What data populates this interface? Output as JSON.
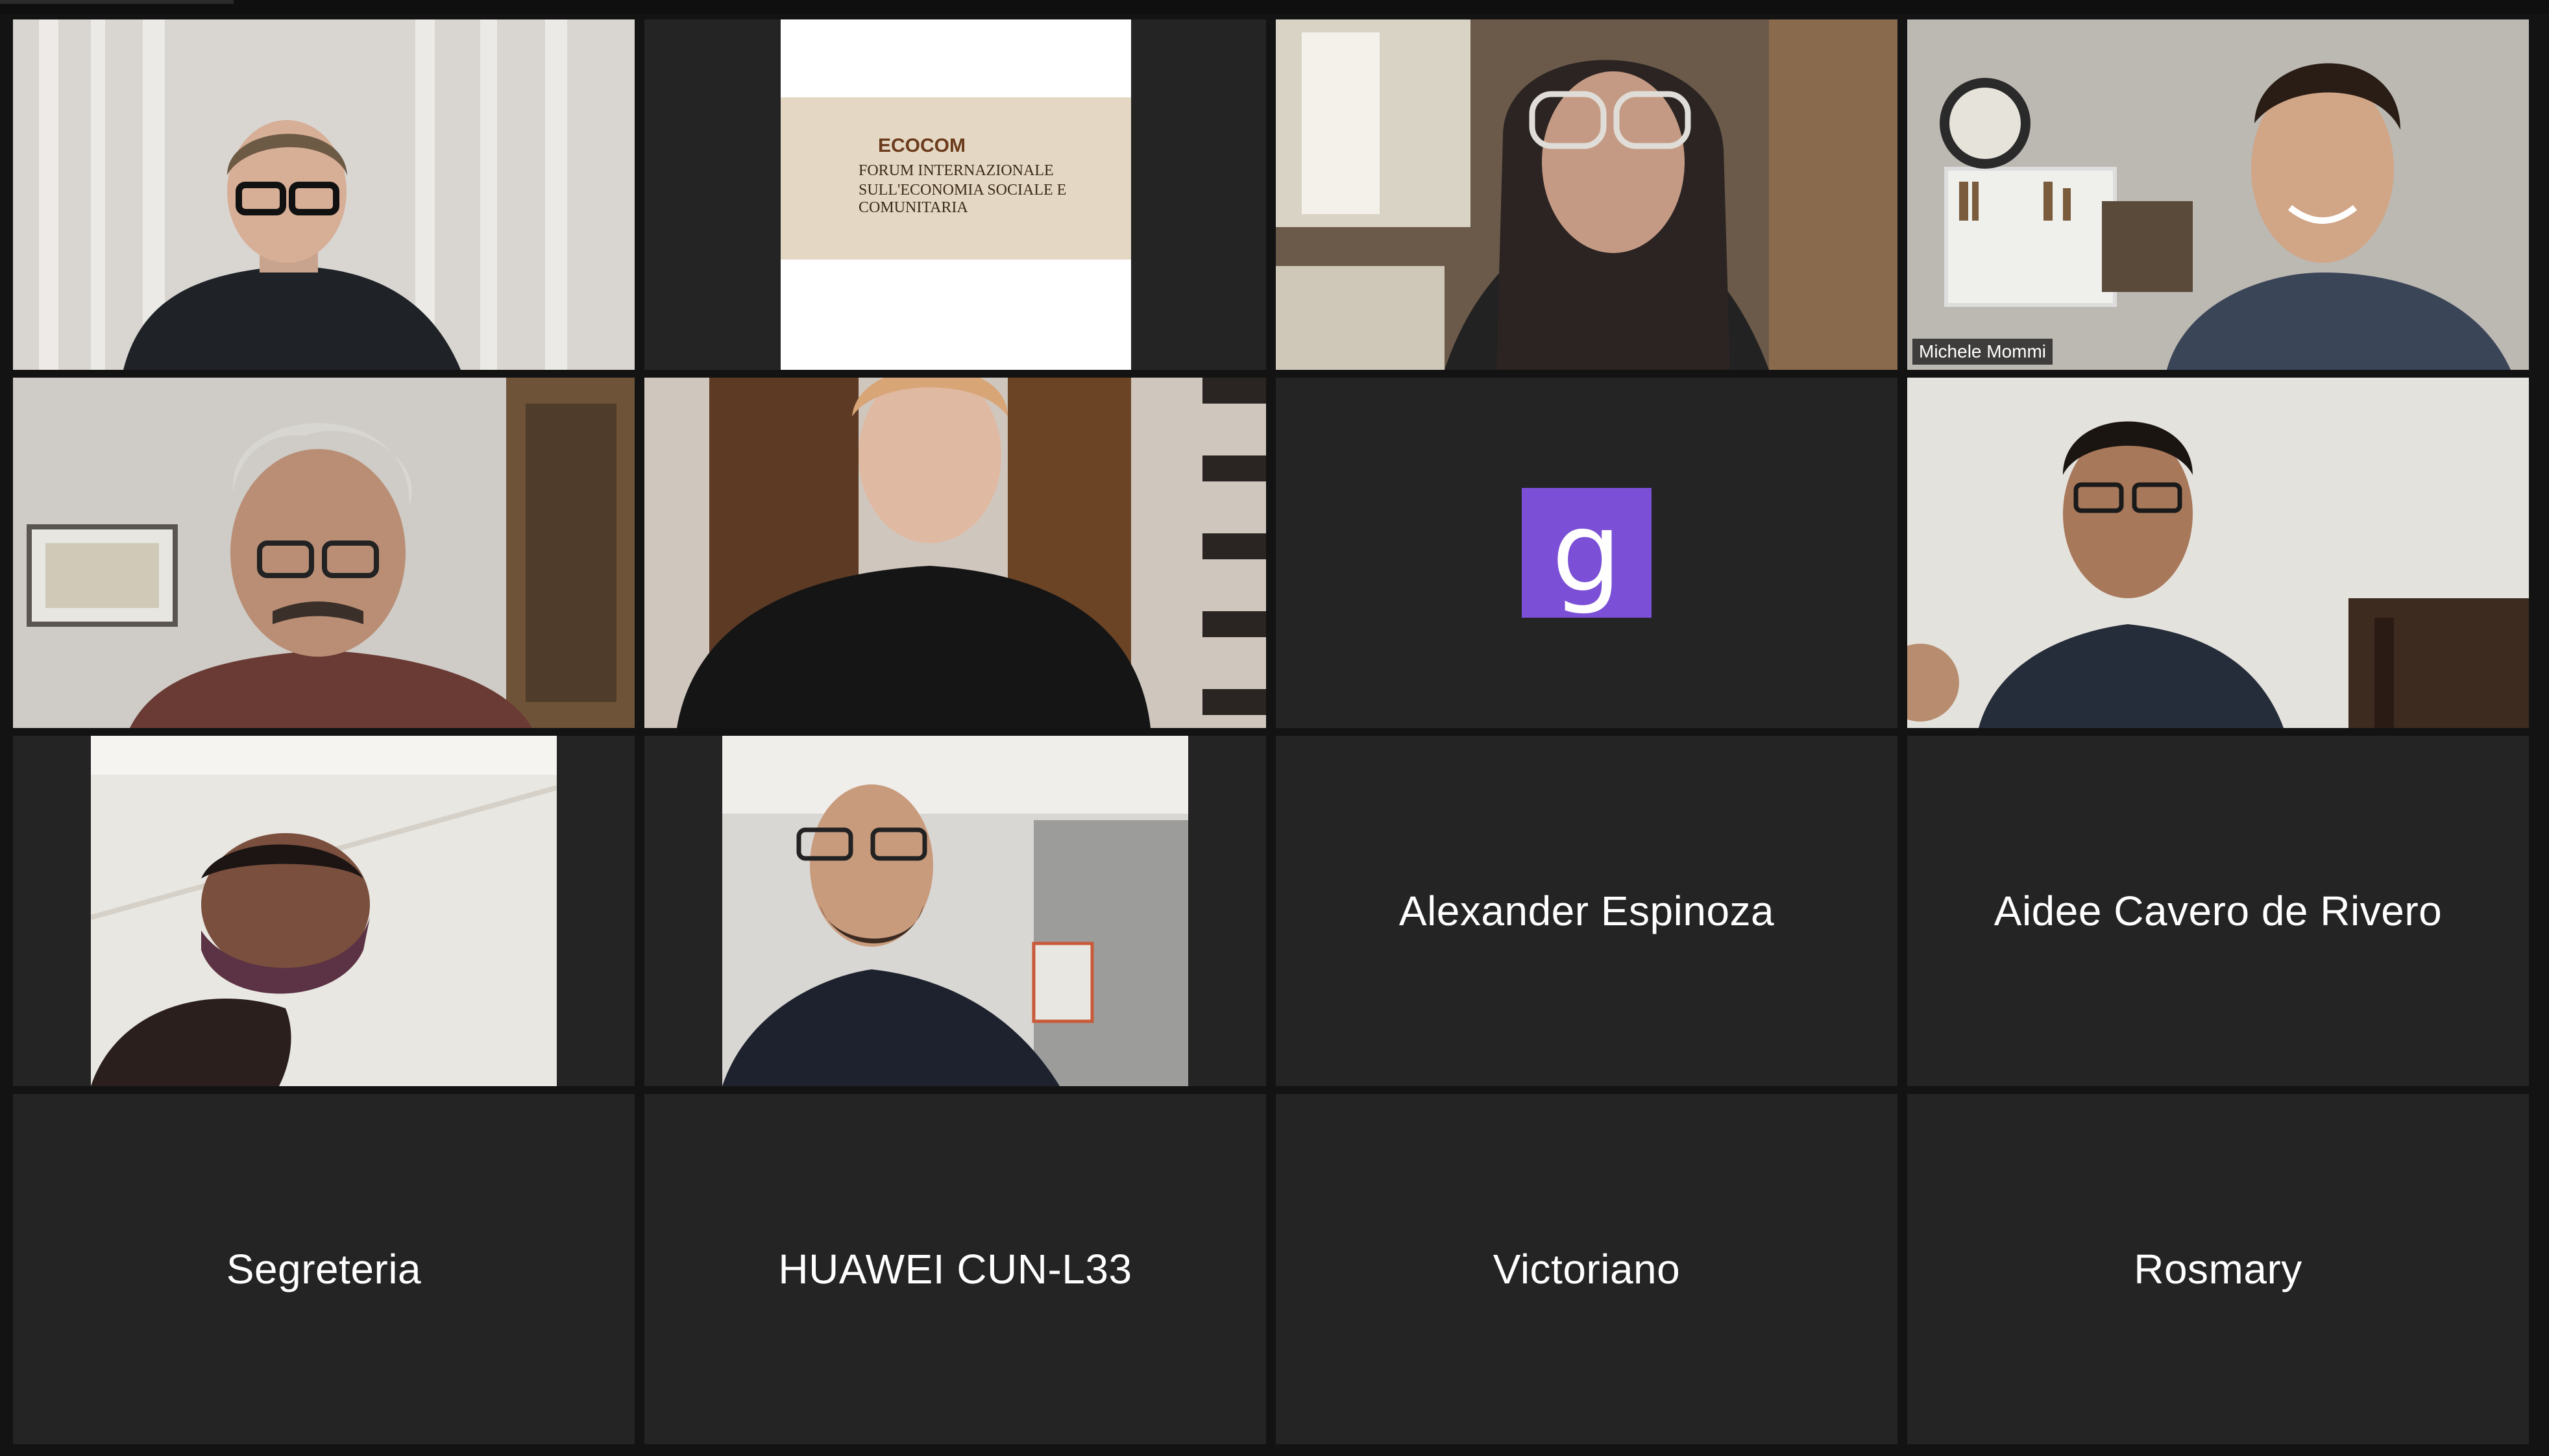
{
  "meeting": {
    "active_speaker_color": "#cfd98a",
    "tile_background": "#242424"
  },
  "participants": [
    {
      "id": "p1",
      "type": "video",
      "description_icon": "person-video"
    },
    {
      "id": "p2",
      "type": "shared-slide",
      "slide": {
        "logo": "ECOCOM",
        "title_line1": "FORUM INTERNAZIONALE",
        "title_line2": "SULL'ECONOMIA SOCIALE E COMUNITARIA"
      }
    },
    {
      "id": "p3",
      "type": "video"
    },
    {
      "id": "p4",
      "type": "video",
      "name": "Michele Mommi",
      "active": true
    },
    {
      "id": "p5",
      "type": "video"
    },
    {
      "id": "p6",
      "type": "video"
    },
    {
      "id": "p7",
      "type": "avatar",
      "avatar_letter": "g",
      "avatar_color": "#7b4fd6"
    },
    {
      "id": "p8",
      "type": "video"
    },
    {
      "id": "p9",
      "type": "video"
    },
    {
      "id": "p10",
      "type": "video"
    },
    {
      "id": "p11",
      "type": "name",
      "name": "Alexander Espinoza"
    },
    {
      "id": "p12",
      "type": "name",
      "name": "Aidee Cavero de Rivero"
    },
    {
      "id": "p13",
      "type": "name",
      "name": "Segreteria"
    },
    {
      "id": "p14",
      "type": "name",
      "name": "HUAWEI CUN-L33"
    },
    {
      "id": "p15",
      "type": "name",
      "name": "Victoriano"
    },
    {
      "id": "p16",
      "type": "name",
      "name": "Rosmary"
    }
  ]
}
